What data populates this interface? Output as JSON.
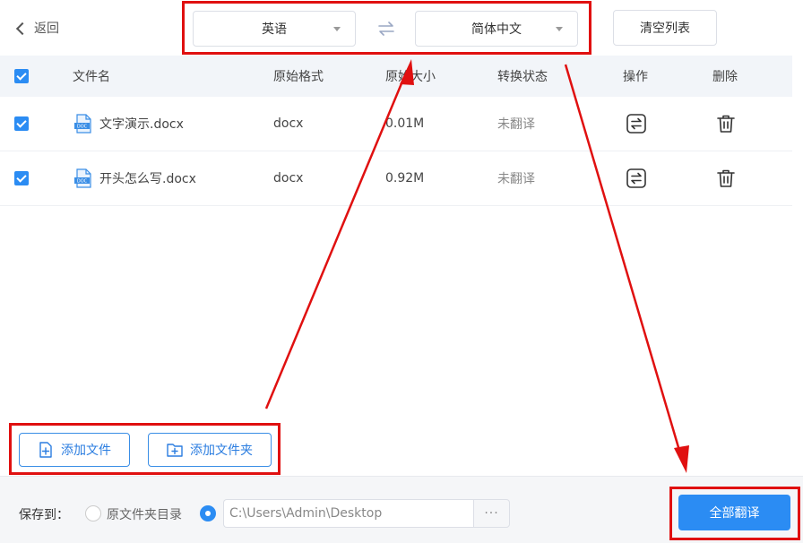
{
  "topbar": {
    "back_label": "返回",
    "source_language": "英语",
    "target_language": "简体中文",
    "clear_label": "清空列表"
  },
  "table": {
    "headers": {
      "filename": "文件名",
      "format": "原始格式",
      "size": "原始大小",
      "status": "转换状态",
      "operation": "操作",
      "delete": "删除"
    },
    "rows": [
      {
        "name": "文字演示.docx",
        "format": "docx",
        "size": "0.01M",
        "status": "未翻译",
        "checked": true
      },
      {
        "name": "开头怎么写.docx",
        "format": "docx",
        "size": "0.92M",
        "status": "未翻译",
        "checked": true
      }
    ]
  },
  "actions": {
    "add_file_label": "添加文件",
    "add_folder_label": "添加文件夹"
  },
  "footer": {
    "save_to_label": "保存到：",
    "option_original_dir": "原文件夹目录",
    "path_value": "C:\\Users\\Admin\\Desktop",
    "browse_label": "···",
    "translate_all_label": "全部翻译"
  },
  "colors": {
    "accent": "#2b8cf3",
    "annotation_red": "#e01010",
    "header_bg": "#f2f5f9"
  }
}
